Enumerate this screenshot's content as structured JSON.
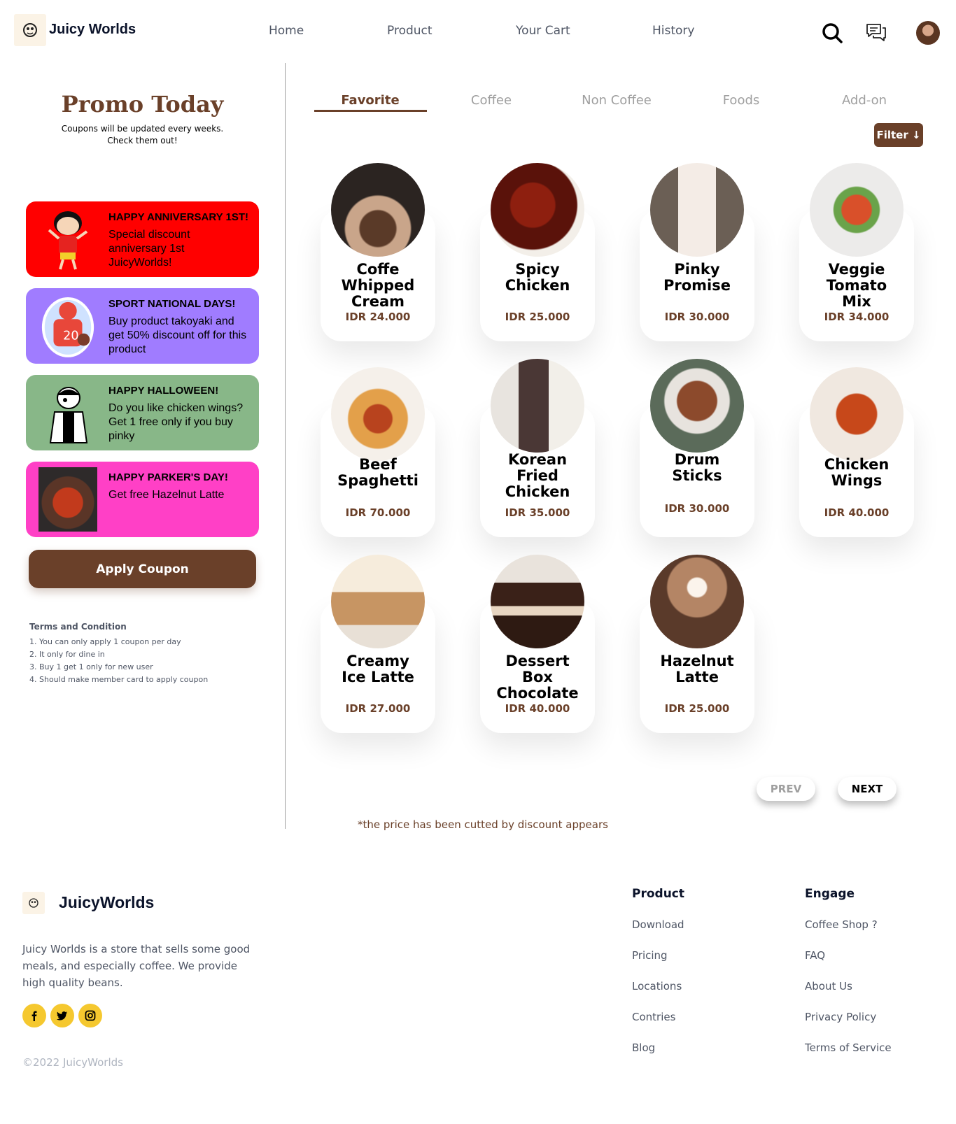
{
  "brand": {
    "name": "Juicy Worlds"
  },
  "nav": {
    "links": [
      "Home",
      "Product",
      "Your Cart",
      "History"
    ],
    "icons": [
      "search-icon",
      "chat-icon",
      "avatar"
    ]
  },
  "promo": {
    "title": "Promo Today",
    "subtitle_line1": "Coupons will be updated every weeks.",
    "subtitle_line2": "Check them out!",
    "coupons": [
      {
        "title": "HAPPY ANNIVERSARY 1ST!",
        "desc": "Special discount anniversary 1st JuicyWorlds!",
        "color": "#ff0000"
      },
      {
        "title": "SPORT NATIONAL DAYS!",
        "desc": "Buy product takoyaki and get 50% discount off for this product",
        "color": "#a07cff"
      },
      {
        "title": "HAPPY HALLOWEEN!",
        "desc": "Do you like chicken wings? Get 1 free only if you buy pinky",
        "color": "#88b788"
      },
      {
        "title": "HAPPY PARKER'S DAY!",
        "desc": "Get free Hazelnut Latte",
        "color": "#ff40c6"
      }
    ],
    "apply_label": "Apply Coupon",
    "terms_title": "Terms and Condition",
    "terms": [
      "1. You can only apply 1 coupon per day",
      "2. It only for dine in",
      "3. Buy 1 get 1 only for new user",
      "4. Should make member card to apply coupon"
    ]
  },
  "tabs": {
    "items": [
      "Favorite",
      "Coffee",
      "Non Coffee",
      "Foods",
      "Add-on"
    ],
    "active": "Favorite"
  },
  "filter_label": "Filter ↓",
  "products": [
    {
      "name_lines": [
        "Coffe",
        "Whipped",
        "Cream"
      ],
      "price": "IDR 24.000"
    },
    {
      "name_lines": [
        "Spicy",
        "Chicken"
      ],
      "price": "IDR 25.000"
    },
    {
      "name_lines": [
        "Pinky",
        "Promise"
      ],
      "price": "IDR 30.000"
    },
    {
      "name_lines": [
        "Veggie",
        "Tomato",
        "Mix"
      ],
      "price": "IDR 34.000"
    },
    {
      "name_lines": [
        "Beef",
        "Spaghetti"
      ],
      "price": "IDR 70.000"
    },
    {
      "name_lines": [
        "Korean",
        "Fried",
        "Chicken"
      ],
      "price": "IDR 35.000"
    },
    {
      "name_lines": [
        "Drum",
        "Sticks"
      ],
      "price": "IDR 30.000"
    },
    {
      "name_lines": [
        "Chicken",
        "Wings"
      ],
      "price": "IDR 40.000"
    },
    {
      "name_lines": [
        "Creamy",
        "Ice Latte"
      ],
      "price": "IDR 27.000"
    },
    {
      "name_lines": [
        "Dessert",
        "Box",
        "Chocolate"
      ],
      "price": "IDR 40.000"
    },
    {
      "name_lines": [
        "Hazelnut",
        "Latte"
      ],
      "price": "IDR 25.000"
    }
  ],
  "pagination": {
    "prev": "PREV",
    "next": "NEXT"
  },
  "note": "*the price has been cutted by discount appears",
  "footer": {
    "brand": "JuicyWorlds",
    "desc": "Juicy Worlds is a store that sells some good meals, and especially coffee. We provide high quality beans.",
    "social": [
      "facebook-icon",
      "twitter-icon",
      "instagram-icon"
    ],
    "copyright": "©2022 JuicyWorlds",
    "product_title": "Product",
    "product_links": [
      "Download",
      "Pricing",
      "Locations",
      "Contries",
      "Blog"
    ],
    "engage_title": "Engage",
    "engage_links": [
      "Coffee Shop ?",
      "FAQ",
      "About Us",
      "Privacy Policy",
      "Terms of Service"
    ]
  },
  "colors": {
    "brand_brown": "#6a4029",
    "text_dark": "#0b132a",
    "text_gray": "#4f5665",
    "social_yellow": "#f5c82f"
  }
}
